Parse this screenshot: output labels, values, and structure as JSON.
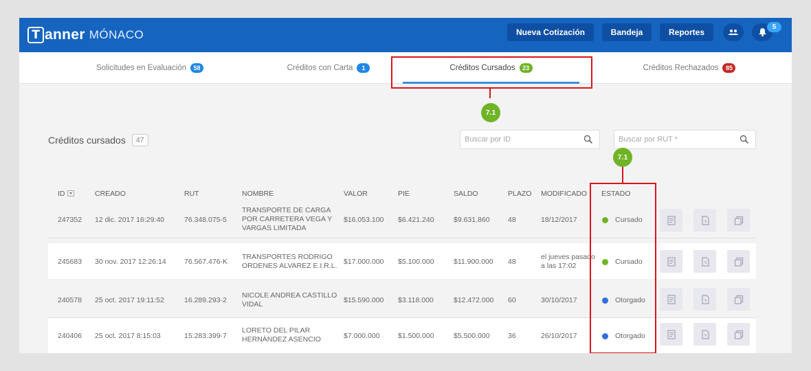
{
  "header": {
    "logo_letter": "T",
    "brand": "anner",
    "brand_sub": "MÓNACO",
    "buttons": {
      "nueva": "Nueva Cotización",
      "bandeja": "Bandeja",
      "reportes": "Reportes"
    },
    "notification_count": "5",
    "color": "#1565c0"
  },
  "tabs": [
    {
      "label": "Solicitudes en Evaluación",
      "badge": "58",
      "badge_color": "#1e88e5"
    },
    {
      "label": "Créditos con Carta",
      "badge": "1",
      "badge_color": "#1e88e5"
    },
    {
      "label": "Créditos Cursados",
      "badge": "23",
      "badge_color": "#6fb426"
    },
    {
      "label": "Créditos Rechazados",
      "badge": "85",
      "badge_color": "#c62828"
    }
  ],
  "annotations": {
    "tab_marker": "7.1",
    "status_marker": "7.1",
    "highlight_color": "#d8141b",
    "marker_color": "#6fb426"
  },
  "section": {
    "title": "Créditos cursados",
    "count": "47"
  },
  "search": {
    "id_placeholder": "Buscar por ID",
    "rut_placeholder": "Buscar por RUT *"
  },
  "table": {
    "columns": [
      "ID",
      "CREADO",
      "RUT",
      "NOMBRE",
      "VALOR",
      "PIE",
      "SALDO",
      "PLAZO",
      "MODIFICADO",
      "ESTADO"
    ],
    "rows": [
      {
        "id": "247352",
        "creado": "12 dic. 2017 16:29:40",
        "rut": "76.348.075-5",
        "nombre": [
          "TRANSPORTE DE CARGA",
          "POR CARRETERA VEGA Y",
          "VARGAS LIMITADA"
        ],
        "valor": "$16.053.100",
        "pie": "$6.421.240",
        "saldo": "$9.631.860",
        "plazo": "48",
        "modificado": [
          "18/12/2017"
        ],
        "estado": "Cursado",
        "estado_color": "#6fb426"
      },
      {
        "id": "245683",
        "creado": "30 nov. 2017 12:26:14",
        "rut": "76.567.476-K",
        "nombre": [
          "TRANSPORTES RODRIGO",
          "ORDENES ALVAREZ E.I.R.L."
        ],
        "valor": "$17.000.000",
        "pie": "$5.100.000",
        "saldo": "$11.900.000",
        "plazo": "48",
        "modificado": [
          "el jueves pasado",
          "a las 17:02"
        ],
        "estado": "Cursado",
        "estado_color": "#6fb426"
      },
      {
        "id": "240578",
        "creado": "25 oct. 2017 19:11:52",
        "rut": "16.289.293-2",
        "nombre": [
          "NICOLE ANDREA CASTILLO",
          "VIDAL"
        ],
        "valor": "$15.590.000",
        "pie": "$3.118.000",
        "saldo": "$12.472.000",
        "plazo": "60",
        "modificado": [
          "30/10/2017"
        ],
        "estado": "Otorgado",
        "estado_color": "#2f6fe0"
      },
      {
        "id": "240406",
        "creado": "25 oct. 2017 8:15:03",
        "rut": "15.283.399-7",
        "nombre": [
          "LORETO DEL PILAR",
          "HERNÁNDEZ ASENCIO"
        ],
        "valor": "$7.000.000",
        "pie": "$1.500.000",
        "saldo": "$5.500.000",
        "plazo": "36",
        "modificado": [
          "26/10/2017"
        ],
        "estado": "Otorgado",
        "estado_color": "#2f6fe0"
      }
    ]
  }
}
